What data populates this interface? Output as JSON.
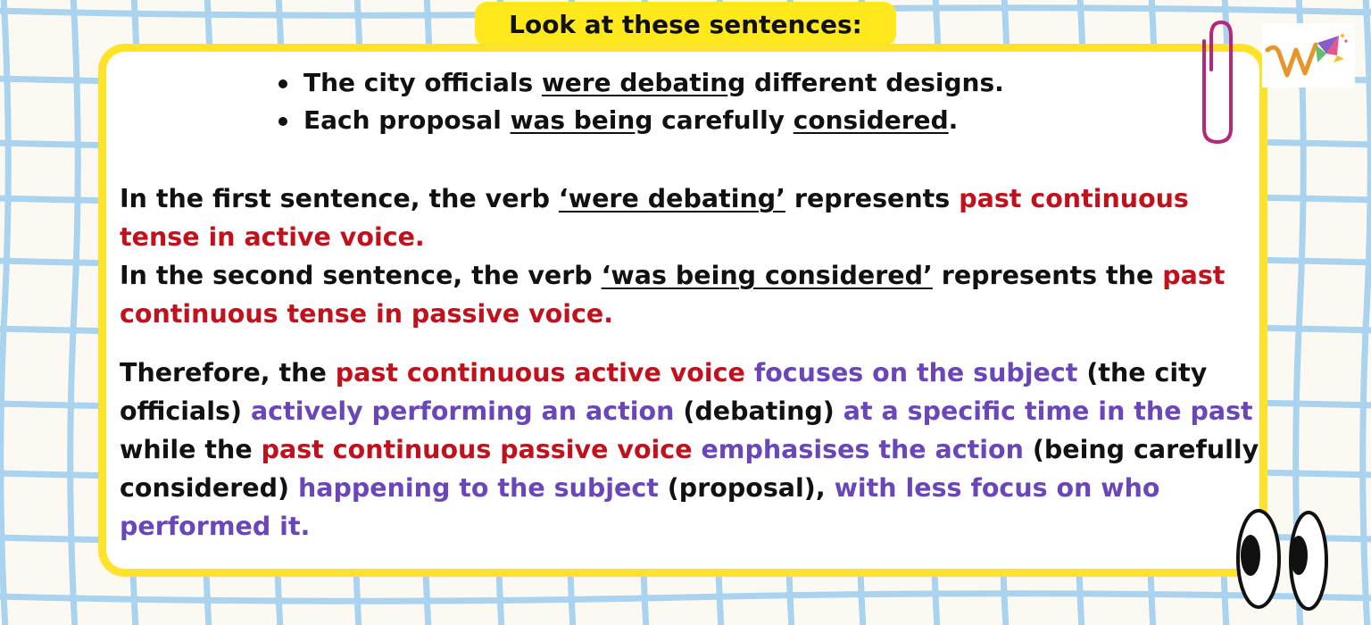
{
  "title": "Look at these sentences:",
  "bullets": [
    {
      "before": "The city officials ",
      "underlined": "were debatin",
      "after": "g different designs."
    },
    {
      "before": "Each proposal ",
      "underlined_1": "was bein",
      "middle": "g carefully ",
      "underlined_2": "considered",
      "after": "."
    }
  ],
  "paragraph_1": {
    "line1_text": "In the first sentence, the verb ",
    "line1_verb": "‘were debating’",
    "line1_mid": " represents ",
    "line1_highlight": "past continuous tense in active voice.",
    "line2_text": "In the second sentence, the verb ",
    "line2_verb_a": "‘was bein",
    "line2_verb_b": "g considered’",
    "line2_mid": " represents the ",
    "line2_highlight": "past continuous tense in passive voice."
  },
  "paragraph_2": {
    "s1": "Therefore, the ",
    "s2": "past continuous active voice",
    "s3": " ",
    "s4": "focuses on the subject",
    "s5": " (the city officials) ",
    "s6": "actively performing an action",
    "s7": " (debating) ",
    "s8": "at a specific time in the past",
    "s9": " while the ",
    "s10": "past continuous passive voice",
    "s11": " ",
    "s12": "emphasises the action",
    "s13": " (being carefully considered) ",
    "s14": "happening to the subject",
    "s15": " (proposal), ",
    "s16": "with less focus on who performed it."
  },
  "colors": {
    "background": "#fbf9f2",
    "grid_lines": "#a9d3ee",
    "title_tab": "#ffe91c",
    "card_border": "#ffe32a",
    "highlight_red": "#c0111c",
    "highlight_purple": "#6a47b8",
    "paperclip": "#b3287a"
  },
  "icons": {
    "logo": "w-brand-logo-icon",
    "paperclip": "paperclip-icon",
    "eyes": "cartoon-eyes-icon"
  }
}
